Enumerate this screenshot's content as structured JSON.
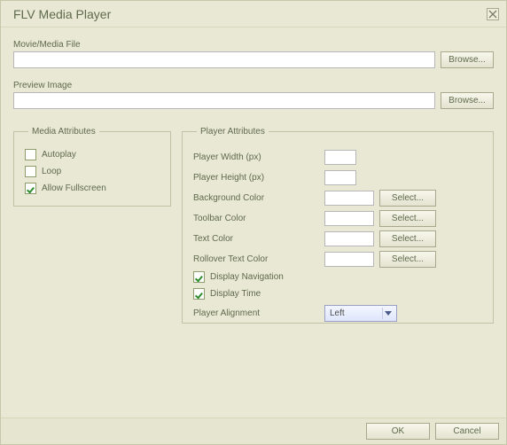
{
  "dialog": {
    "title": "FLV Media Player",
    "close_tooltip": "Close"
  },
  "fields": {
    "movie_label": "Movie/Media File",
    "movie_value": "",
    "browse1": "Browse...",
    "preview_label": "Preview Image",
    "preview_value": "",
    "browse2": "Browse..."
  },
  "media_attrs": {
    "legend": "Media Attributes",
    "autoplay_label": "Autoplay",
    "autoplay_checked": false,
    "loop_label": "Loop",
    "loop_checked": false,
    "fullscreen_label": "Allow Fullscreen",
    "fullscreen_checked": true
  },
  "player_attrs": {
    "legend": "Player Attributes",
    "width_label": "Player Width (px)",
    "width_value": "",
    "height_label": "Player Height (px)",
    "height_value": "",
    "bg_label": "Background Color",
    "bg_value": "",
    "bg_select": "Select...",
    "toolbar_label": "Toolbar Color",
    "toolbar_value": "",
    "toolbar_select": "Select...",
    "text_label": "Text Color",
    "text_value": "",
    "text_select": "Select...",
    "rollover_label": "Rollover Text Color",
    "rollover_value": "",
    "rollover_select": "Select...",
    "nav_label": "Display Navigation",
    "nav_checked": true,
    "time_label": "Display Time",
    "time_checked": true,
    "align_label": "Player Alignment",
    "align_value": "Left"
  },
  "footer": {
    "ok": "OK",
    "cancel": "Cancel"
  }
}
